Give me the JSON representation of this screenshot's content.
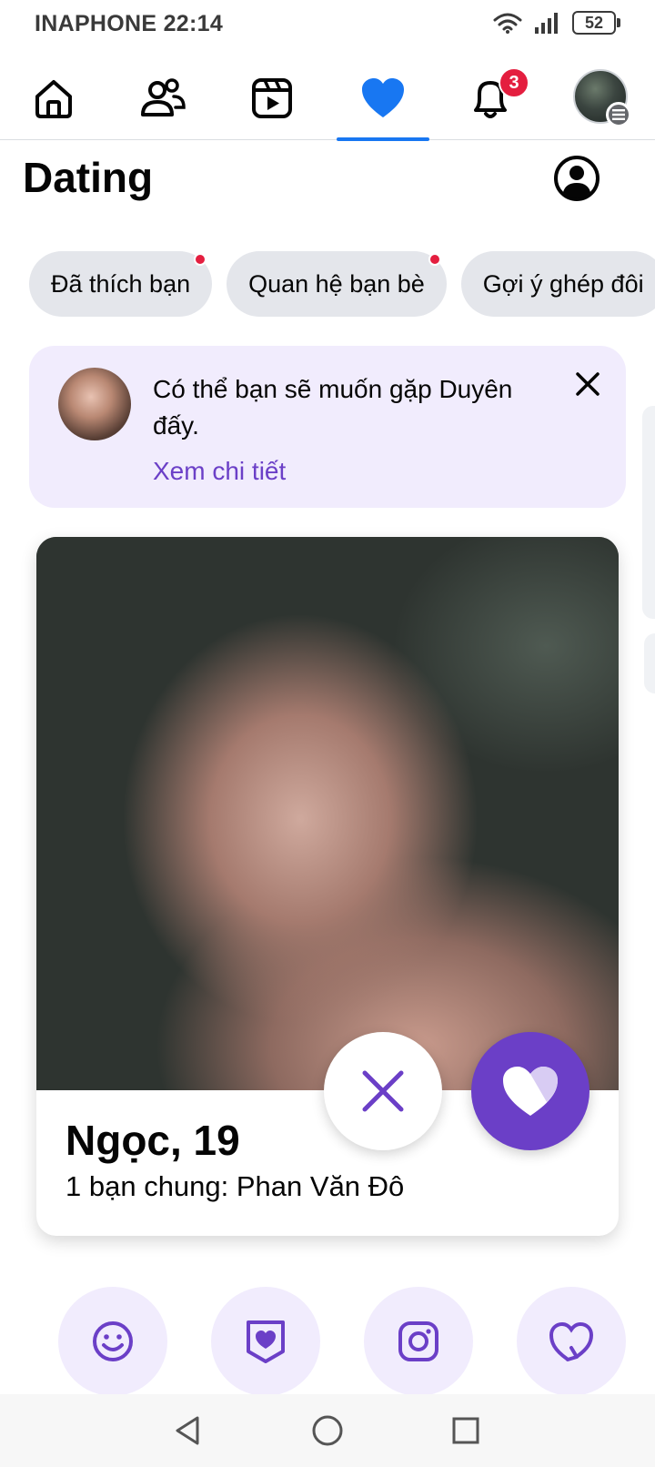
{
  "status_bar": {
    "carrier_time": "INAPHONE 22:14",
    "battery": "52",
    "icons": [
      "wifi-icon",
      "signal-icon",
      "battery-icon"
    ]
  },
  "top_nav": {
    "items": [
      {
        "name": "home",
        "icon": "home-icon",
        "active": false
      },
      {
        "name": "friends",
        "icon": "friends-icon",
        "active": false
      },
      {
        "name": "video",
        "icon": "video-icon",
        "active": false
      },
      {
        "name": "dating",
        "icon": "heart-icon",
        "active": true
      },
      {
        "name": "notifications",
        "icon": "bell-icon",
        "active": false,
        "badge": "3"
      },
      {
        "name": "profile-menu",
        "icon": "avatar",
        "active": false
      }
    ],
    "accent": "#1877f2",
    "badge_color": "#e41e3f"
  },
  "header": {
    "title": "Dating",
    "profile_icon": "user-circle-icon"
  },
  "chips": [
    {
      "label": "Đã thích bạn",
      "dot": true
    },
    {
      "label": "Quan hệ bạn bè",
      "dot": true
    },
    {
      "label": "Gợi ý ghép đôi",
      "dot": false
    }
  ],
  "suggestion": {
    "text": "Có thể bạn sẽ muốn gặp Duyên đấy.",
    "link": "Xem chi tiết",
    "close_icon": "close-icon"
  },
  "profile_card": {
    "name_age": "Ngọc, 19",
    "mutual": "1 bạn chung: Phan Văn Đô",
    "pass_icon": "close-icon",
    "like_icon": "heart-icon",
    "brand": "#6b3fc7"
  },
  "bottom_actions": [
    {
      "name": "smile",
      "icon": "smile-icon"
    },
    {
      "name": "secret-crush",
      "icon": "heart-shield-icon"
    },
    {
      "name": "instagram",
      "icon": "instagram-icon"
    },
    {
      "name": "second-look",
      "icon": "heart-arrow-icon"
    }
  ],
  "system_nav": [
    "back-icon",
    "home-circle-icon",
    "recents-icon"
  ]
}
